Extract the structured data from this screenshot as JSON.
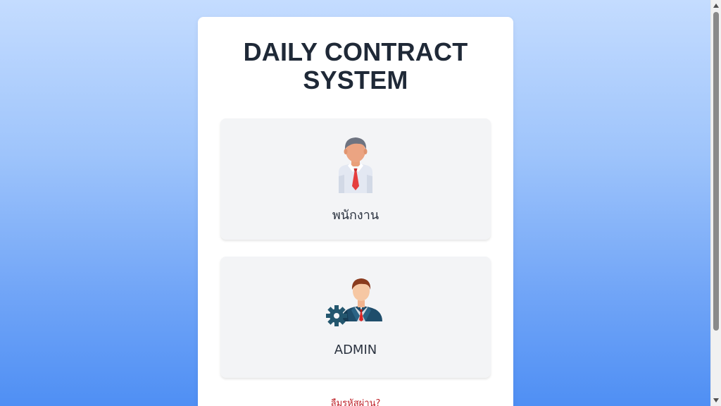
{
  "header": {
    "title_line1": "DAILY CONTRACT",
    "title_line2": "SYSTEM"
  },
  "roles": [
    {
      "label": "พนักงาน",
      "icon": "employee-icon"
    },
    {
      "label": "ADMIN",
      "icon": "admin-gear-icon"
    }
  ],
  "footer": {
    "forgot_password": "ลืมรหัสผ่าน?"
  },
  "colors": {
    "accent_link": "#c0262d",
    "tile_bg": "#f3f4f6",
    "title": "#1f2937"
  }
}
